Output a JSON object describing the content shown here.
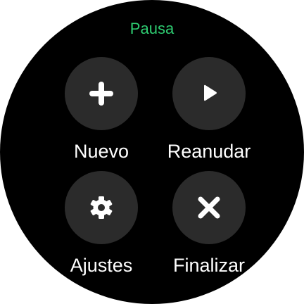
{
  "screen": {
    "title": "Pausa",
    "title_color": "#2ecc71",
    "background_color": "#000000",
    "button_color": "#2b2b2b"
  },
  "actions": [
    {
      "label": "Nuevo",
      "icon": "plus-icon"
    },
    {
      "label": "Reanudar",
      "icon": "play-icon"
    },
    {
      "label": "Ajustes",
      "icon": "gear-icon"
    },
    {
      "label": "Finalizar",
      "icon": "close-icon"
    }
  ]
}
